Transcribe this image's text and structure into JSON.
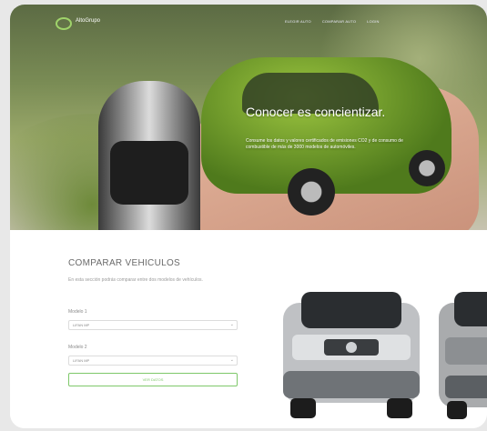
{
  "header": {
    "brand": "AltoGrupo",
    "nav": [
      "ELEGIR AUTO",
      "COMPARAR AUTO",
      "LOGIN"
    ]
  },
  "hero": {
    "headline": "Conocer es concientizar.",
    "subline": "Consume los datos y valores certificados de emisiones CO2 y de consumo de combustible de más de 3000 modelos de automóviles."
  },
  "compare": {
    "title": "COMPARAR VEHICULOS",
    "description": "En esta sección podrás comparar entre dos modelos de vehículos.",
    "model1_label": "Modelo 1",
    "model1_value": "LIFAN MP",
    "model2_label": "Modelo 2",
    "model2_value": "LIFAN MP",
    "button_label": "VER DATOS"
  },
  "colors": {
    "accent": "#7ec86a",
    "title": "#6a6a6a"
  }
}
